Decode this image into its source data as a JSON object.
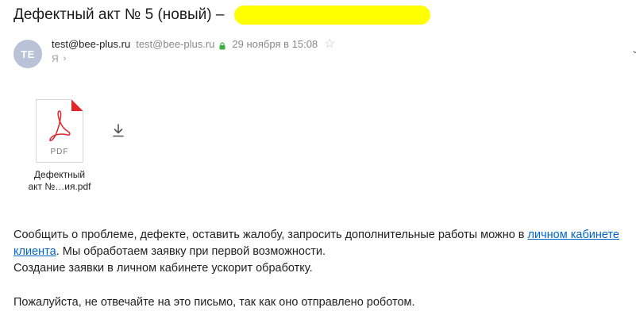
{
  "email": {
    "subject": "Дефектный акт № 5 (новый) –",
    "avatar_initials": "TE",
    "sender_name": "test@bee-plus.ru",
    "sender_email": "test@bee-plus.ru",
    "date": "29 ноября в 15:08",
    "recipient": "Я",
    "attachment": {
      "type_label": "PDF",
      "name_line1": "Дефектный",
      "name_line2": "акт №…ия.pdf"
    },
    "body": {
      "p1_text": "Сообщить о проблеме, дефекте, оставить жалобу, запросить дополнительные работы можно в ",
      "p1_link": "личном кабинете клиента",
      "p1_tail": ". Мы обработаем заявку при первой возможности.",
      "p2": "Создание заявки в личном кабинете ускорит обработку.",
      "p3": "Пожалуйста, не отвечайте на это письмо, так как оно отправлено роботом."
    }
  },
  "colors": {
    "highlight": "#ffff00",
    "avatar_bg": "#b9c2d6",
    "link": "#0066cc",
    "lock": "#3cb043",
    "pdf_red": "#e0252b"
  },
  "icons": {
    "lock": "lock-icon",
    "star": "star-icon",
    "download": "download-icon",
    "pdf": "pdf-file-icon"
  }
}
